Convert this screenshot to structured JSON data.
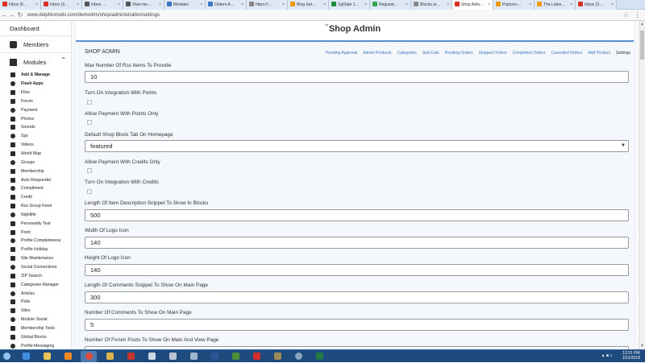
{
  "browser": {
    "tabs": [
      {
        "label": "Inbox (5…",
        "color": "#d93025"
      },
      {
        "label": "Inbox (3…",
        "color": "#d93025"
      },
      {
        "label": "Inbox …",
        "color": "#555555"
      },
      {
        "label": "View mo…",
        "color": "#555555"
      },
      {
        "label": "Modules",
        "color": "#3b78c4"
      },
      {
        "label": "Orders A…",
        "color": "#3b78c4"
      },
      {
        "label": "https://…",
        "color": "#888888"
      },
      {
        "label": "Blog Set…",
        "color": "#f29900"
      },
      {
        "label": "SqlSide 1…",
        "color": "#1e8e3e"
      },
      {
        "label": "Request…",
        "color": "#34a853"
      },
      {
        "label": "Blocks ar…",
        "color": "#888888"
      },
      {
        "label": "Shop Adm…",
        "color": "#d93025"
      },
      {
        "label": "Popcorn…",
        "color": "#f29900"
      },
      {
        "label": "The Lates…",
        "color": "#f29900"
      },
      {
        "label": "Inbox (3…",
        "color": "#d93025"
      }
    ],
    "active_tab_index": 11,
    "url": "www.dolphinmods.com/demo4/m/shop/administration/settings"
  },
  "sidebar": {
    "top_item": "Dashboard",
    "members": "Members",
    "modules": "Modules",
    "items": [
      {
        "label": "Add & Manage",
        "bold": true
      },
      {
        "label": "Flash Apps",
        "bold": true
      },
      {
        "label": "Files",
        "bold": false
      },
      {
        "label": "Forum",
        "bold": false
      },
      {
        "label": "Payment",
        "bold": false
      },
      {
        "label": "Photos",
        "bold": false
      },
      {
        "label": "Sounds",
        "bold": false
      },
      {
        "label": "Spy",
        "bold": false
      },
      {
        "label": "Videos",
        "bold": false
      },
      {
        "label": "World Map",
        "bold": false
      },
      {
        "label": "Groups",
        "bold": false
      },
      {
        "label": "Membership",
        "bold": false
      },
      {
        "label": "Auto Responder",
        "bold": false
      },
      {
        "label": "Compliment",
        "bold": false
      },
      {
        "label": "Credit",
        "bold": false
      },
      {
        "label": "Rss Group Feed",
        "bold": false
      },
      {
        "label": "Nightlife",
        "bold": false
      },
      {
        "label": "Personality Test",
        "bold": false
      },
      {
        "label": "Point",
        "bold": false
      },
      {
        "label": "Profile Completeness",
        "bold": false
      },
      {
        "label": "Profile Holiday",
        "bold": false
      },
      {
        "label": "Site Maintenance",
        "bold": false
      },
      {
        "label": "Social Connections",
        "bold": false
      },
      {
        "label": "ZIP Search",
        "bold": false
      },
      {
        "label": "Categories Manager",
        "bold": false
      },
      {
        "label": "Articles",
        "bold": false
      },
      {
        "label": "Polls",
        "bold": false
      },
      {
        "label": "Sites",
        "bold": false
      },
      {
        "label": "Module Social",
        "bold": false
      },
      {
        "label": "Membership Tools",
        "bold": false
      },
      {
        "label": "Global Blocks",
        "bold": false
      },
      {
        "label": "Profile Messaging",
        "bold": false
      }
    ]
  },
  "page": {
    "title": "Shop Admin",
    "section_label": "SHOP ADMIN",
    "links": [
      "Pending Approval",
      "Admin Products",
      "Categories",
      "Sub-Cats",
      "Pending Orders",
      "Shipped Orders",
      "Completed Orders",
      "Cancelled Orders",
      "Add Product",
      "Settings"
    ],
    "fields": {
      "rss_label": "Max Number Of Rss Items To Provide",
      "rss_value": "10",
      "points_integration_label": "Turn On Integration With Points",
      "points_only_label": "Allow Payment With Points Only",
      "default_tab_label": "Default Shop Block Tab On Homepage",
      "default_tab_value": "featured",
      "credits_only_label": "Allow Payment With Credits Only",
      "credits_integration_label": "Turn On Integration With Credits",
      "snippet_label": "Length Of Item Description Snippet To Show In Blocks",
      "snippet_value": "500",
      "logo_width_label": "Width Of Logo Icon",
      "logo_width_value": "140",
      "logo_height_label": "Height Of Logo Icon",
      "logo_height_value": "140",
      "comments_snippet_label": "Length Of Comments Snippet To Show On Main Page",
      "comments_snippet_value": "300",
      "comments_count_label": "Number Of Comments To Show On Main Page",
      "comments_count_value": "5",
      "forum_posts_label": "Number Of Forum Posts To Show On Main And View Page"
    }
  },
  "taskbar": {
    "time": "12:21 PM",
    "date": "1/31/2018"
  }
}
